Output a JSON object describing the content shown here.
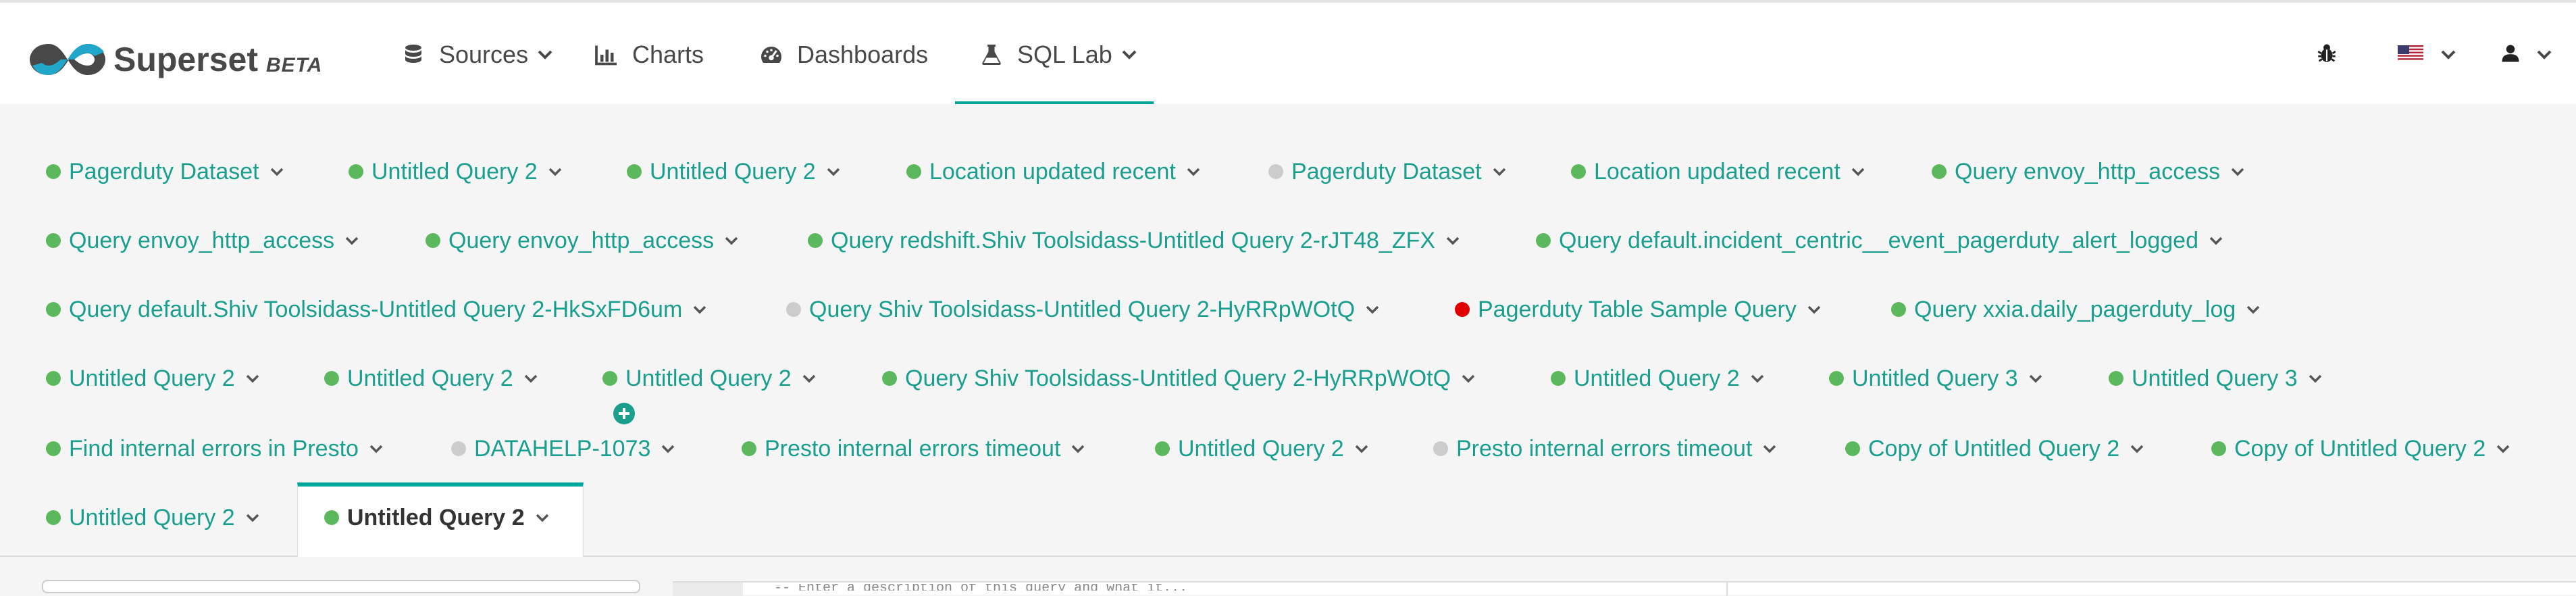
{
  "brand": {
    "name": "Superset",
    "badge": "BETA"
  },
  "nav": {
    "sources": "Sources",
    "charts": "Charts",
    "dashboards": "Dashboards",
    "sql_lab": "SQL Lab"
  },
  "colors": {
    "accent": "#00a699",
    "status_success": "#5cb85c",
    "status_idle": "#cccccc",
    "status_error": "#e00000"
  },
  "query_tabs": [
    {
      "label": "Pagerduty Dataset",
      "status": "success"
    },
    {
      "label": "Untitled Query 2",
      "status": "success"
    },
    {
      "label": "Untitled Query 2",
      "status": "success"
    },
    {
      "label": "Location updated recent",
      "status": "success"
    },
    {
      "label": "Pagerduty Dataset",
      "status": "idle"
    },
    {
      "label": "Location updated recent",
      "status": "success"
    },
    {
      "label": "Query envoy_http_access",
      "status": "success"
    },
    {
      "label": "Query envoy_http_access",
      "status": "success"
    },
    {
      "label": "Query envoy_http_access",
      "status": "success"
    },
    {
      "label": "Query redshift.Shiv Toolsidass-Untitled Query 2-rJT48_ZFX",
      "status": "success"
    },
    {
      "label": "Query default.incident_centric__event_pagerduty_alert_logged",
      "status": "success"
    },
    {
      "label": "Query default.Shiv Toolsidass-Untitled Query 2-HkSxFD6um",
      "status": "success"
    },
    {
      "label": "Query Shiv Toolsidass-Untitled Query 2-HyRRpWOtQ",
      "status": "idle"
    },
    {
      "label": "Pagerduty Table Sample Query",
      "status": "error"
    },
    {
      "label": "Query xxia.daily_pagerduty_log",
      "status": "success"
    },
    {
      "label": "Untitled Query 2",
      "status": "success"
    },
    {
      "label": "Untitled Query 2",
      "status": "success"
    },
    {
      "label": "Untitled Query 2",
      "status": "success"
    },
    {
      "label": "Query Shiv Toolsidass-Untitled Query 2-HyRRpWOtQ",
      "status": "success"
    },
    {
      "label": "Untitled Query 2",
      "status": "success"
    },
    {
      "label": "Untitled Query 3",
      "status": "success"
    },
    {
      "label": "Untitled Query 3",
      "status": "success"
    },
    {
      "label": "Find internal errors in Presto",
      "status": "success"
    },
    {
      "label": "DATAHELP-1073",
      "status": "idle"
    },
    {
      "label": "Presto internal errors timeout",
      "status": "success"
    },
    {
      "label": "Untitled Query 2",
      "status": "success"
    },
    {
      "label": "Presto internal errors timeout",
      "status": "idle"
    },
    {
      "label": "Copy of Untitled Query 2",
      "status": "success"
    },
    {
      "label": "Copy of Untitled Query 2",
      "status": "success"
    },
    {
      "label": "Untitled Query 2",
      "status": "success"
    }
  ],
  "active_tab": {
    "label": "Untitled Query 2",
    "status": "success"
  },
  "editor_preview": "-- Enter a description of this query and what it..."
}
